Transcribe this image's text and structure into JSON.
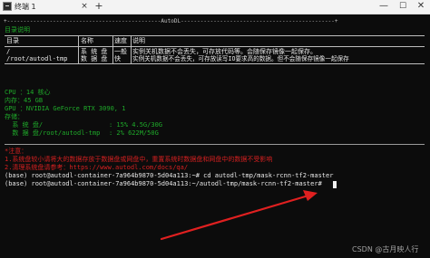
{
  "window": {
    "tab_title": "终端 1",
    "tab_close": "×",
    "new_tab": "+",
    "min": "—",
    "max": "☐",
    "close": "✕"
  },
  "banner": {
    "header": "+-----------------------------------------------AutoDL-----------------------------------------------+",
    "section_title": "目录说明",
    "col_dir": "目录",
    "col_name": "名称",
    "col_speed": "速度",
    "col_desc": "说明",
    "row1_dir": "/",
    "row1_name": "系 统 盘",
    "row1_speed": "一般",
    "row1_desc": "实例关机数据不会丢失，可存放代码等。会随保存镜像一起保存。",
    "row2_dir": "/root/autodl-tmp",
    "row2_name": "数 据 盘",
    "row2_speed": "快",
    "row2_desc": "实例关机数据不会丢失，可存放读写IO要求高的数据。但不会随保存镜像一起保存"
  },
  "resources": {
    "cpu": "CPU ：14 核心",
    "mem": "内存：45 GB",
    "gpu": "GPU ：NVIDIA GeForce RTX 3090, 1",
    "storage": "存储：",
    "sys_label": "  系 统 盘/",
    "sys_value": ": 15% 4.5G/30G",
    "data_label": "  数 据 盘/root/autodl-tmp",
    "data_value": ": 2% 622M/50G"
  },
  "tips": {
    "title": "*注意：",
    "line1": "1.系统盘较小请将大的数据存放于数据盘或网盘中，重置系统时数据盘和网盘中的数据不受影响",
    "line2": "2.清理系统盘请参考：https://www.autodl.com/docs/qa/"
  },
  "prompt1": "(base) root@autodl-container-7a964b9870-5d04a113:~# cd autodl-tmp/mask-rcnn-tf2-master",
  "prompt2": "(base) root@autodl-container-7a964b9870-5d04a113:~/autodl-tmp/mask-rcnn-tf2-master# ",
  "watermark": "CSDN @古月映人行",
  "colors": {
    "terminal_bg": "#0c0c0c",
    "green": "#1faa2a",
    "red": "#d42020",
    "arrow": "#e02020"
  }
}
